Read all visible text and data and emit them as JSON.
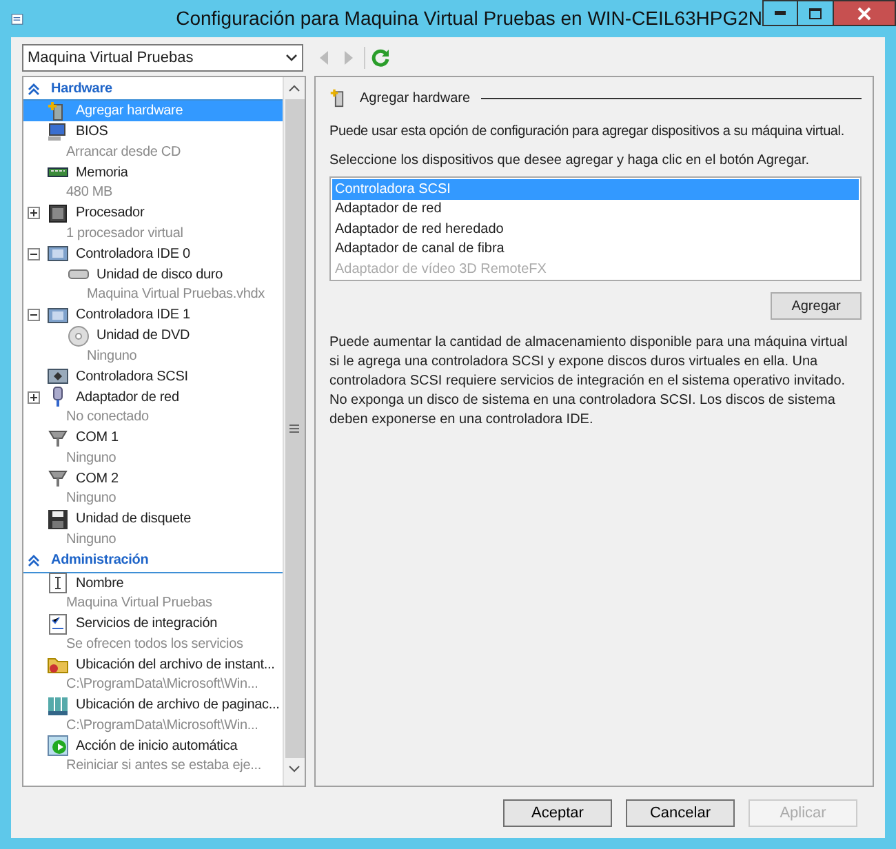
{
  "window": {
    "title": "Configuración para Maquina Virtual Pruebas en WIN-CEIL63HPG2N"
  },
  "vm_selector": {
    "value": "Maquina Virtual Pruebas"
  },
  "sidebar": {
    "sections": [
      {
        "title": "Hardware",
        "expanded": true,
        "items": [
          {
            "label": "Agregar hardware",
            "selected": true
          },
          {
            "label": "BIOS",
            "detail": "Arrancar desde CD",
            "selected": false
          },
          {
            "label": "Memoria",
            "detail": "480 MB",
            "selected": false
          },
          {
            "label": "Procesador",
            "detail": "1 procesador virtual",
            "selected": false,
            "expanded": false
          },
          {
            "label": "Controladora IDE 0",
            "selected": false,
            "expanded": true,
            "children": [
              {
                "label": "Unidad de disco duro",
                "detail": "Maquina Virtual Pruebas.vhdx",
                "selected": false
              }
            ]
          },
          {
            "label": "Controladora IDE 1",
            "selected": false,
            "expanded": true,
            "children": [
              {
                "label": "Unidad de DVD",
                "detail": "Ninguno",
                "selected": false
              }
            ]
          },
          {
            "label": "Controladora SCSI",
            "selected": false
          },
          {
            "label": "Adaptador de red",
            "detail": "No conectado",
            "selected": false,
            "expanded": false
          },
          {
            "label": "COM 1",
            "detail": "Ninguno",
            "selected": false
          },
          {
            "label": "COM 2",
            "detail": "Ninguno",
            "selected": false
          },
          {
            "label": "Unidad de disquete",
            "detail": "Ninguno",
            "selected": false
          }
        ]
      },
      {
        "title": "Administración",
        "expanded": true,
        "items": [
          {
            "label": "Nombre",
            "detail": "Maquina Virtual Pruebas",
            "selected": false
          },
          {
            "label": "Servicios de integración",
            "detail": "Se ofrecen todos los servicios",
            "selected": false
          },
          {
            "label": "Ubicación del archivo de instant...",
            "detail": "C:\\ProgramData\\Microsoft\\Win...",
            "selected": false
          },
          {
            "label": "Ubicación de archivo de paginac...",
            "detail": "C:\\ProgramData\\Microsoft\\Win...",
            "selected": false
          },
          {
            "label": "Acción de inicio automática",
            "detail": "Reiniciar si antes se estaba eje...",
            "selected": false
          }
        ]
      }
    ]
  },
  "panel": {
    "heading": "Agregar hardware",
    "intro": "Puede usar esta opción de configuración para agregar dispositivos a su máquina virtual.",
    "instruction": "Seleccione los dispositivos que desee agregar y haga clic en el botón Agregar.",
    "devices": [
      {
        "label": "Controladora SCSI",
        "selected": true,
        "disabled": false
      },
      {
        "label": "Adaptador de red",
        "selected": false,
        "disabled": false
      },
      {
        "label": "Adaptador de red heredado",
        "selected": false,
        "disabled": false
      },
      {
        "label": "Adaptador de canal de fibra",
        "selected": false,
        "disabled": false
      },
      {
        "label": "Adaptador de vídeo 3D RemoteFX",
        "selected": false,
        "disabled": true
      }
    ],
    "add_button": "Agregar",
    "note": "Puede aumentar la cantidad de almacenamiento disponible para una máquina virtual si le agrega una controladora SCSI y expone discos duros virtuales en ella. Una controladora SCSI requiere servicios de integración en el sistema operativo invitado. No exponga un disco de sistema en una controladora SCSI. Los discos de sistema deben exponerse en una controladora IDE."
  },
  "buttons": [
    {
      "label": "Aceptar",
      "disabled": false
    },
    {
      "label": "Cancelar",
      "disabled": false
    },
    {
      "label": "Aplicar",
      "disabled": true
    }
  ]
}
